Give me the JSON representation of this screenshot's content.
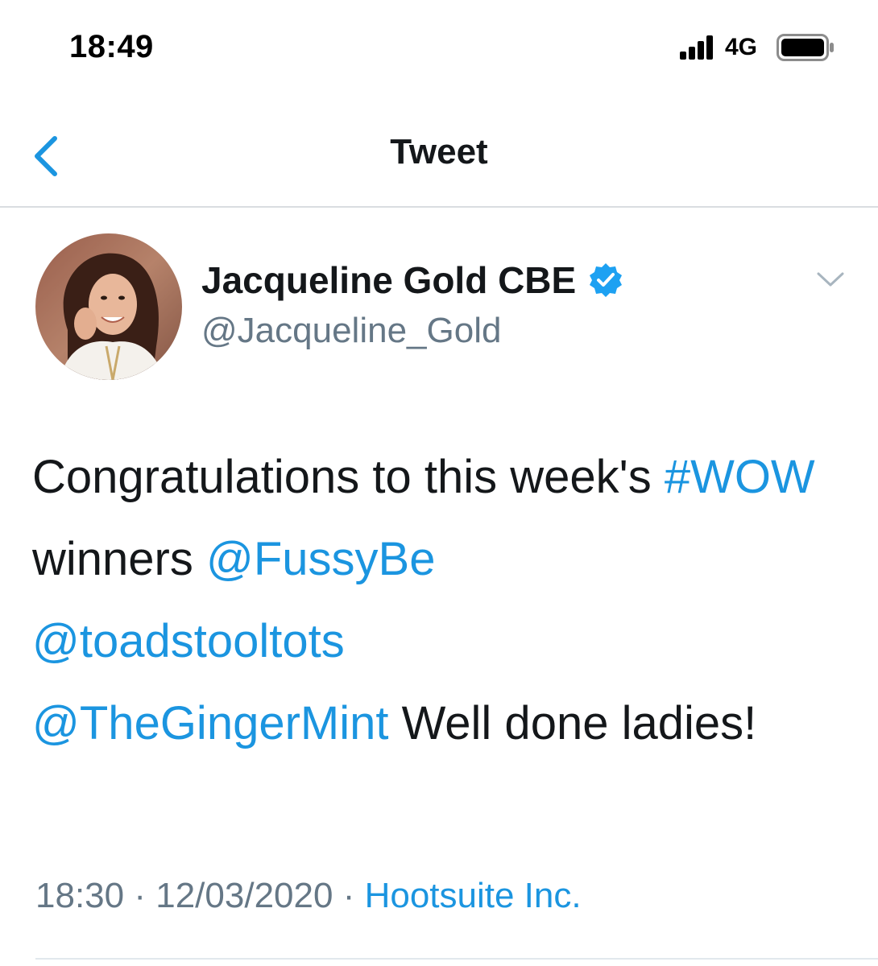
{
  "status_bar": {
    "time": "18:49",
    "network": "4G",
    "signal_icon": "signal-bars-icon",
    "battery_icon": "battery-icon"
  },
  "nav": {
    "title": "Tweet",
    "back_icon": "chevron-left-icon"
  },
  "tweet": {
    "author": {
      "display_name": "Jacqueline Gold CBE",
      "handle": "@Jacqueline_Gold",
      "verified": true
    },
    "text_parts": [
      {
        "text": "Congratulations to this week's ",
        "type": "plain"
      },
      {
        "text": "#WOW",
        "type": "link"
      },
      {
        "text": " winners ",
        "type": "plain"
      },
      {
        "text": "@FussyBe",
        "type": "link"
      },
      {
        "text": " ",
        "type": "plain"
      },
      {
        "text": "@toadstooltots",
        "type": "link"
      },
      {
        "text": " ",
        "type": "plain"
      },
      {
        "text": "@TheGingerMint",
        "type": "link"
      },
      {
        "text": " Well done ladies!",
        "type": "plain"
      }
    ],
    "time": "18:30",
    "separator": "·",
    "date": "12/03/2020",
    "source": "Hootsuite Inc."
  },
  "colors": {
    "accent": "#1b95e0",
    "text": "#14171a",
    "secondary": "#657786",
    "verified": "#1da1f2"
  }
}
